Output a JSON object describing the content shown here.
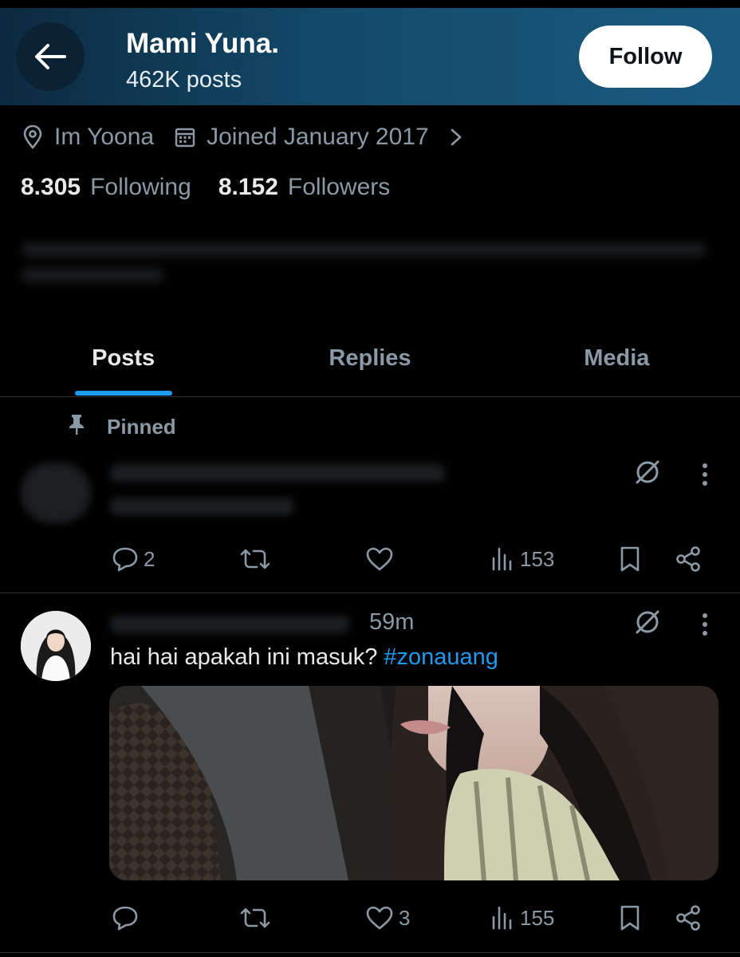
{
  "header": {
    "name": "Mami Yuna.",
    "posts_count": "462K posts",
    "follow_label": "Follow"
  },
  "profile": {
    "location": "Im Yoona",
    "joined": "Joined January 2017",
    "following_count": "8.305",
    "following_label": "Following",
    "followers_count": "8.152",
    "followers_label": "Followers"
  },
  "tabs": [
    {
      "label": "Posts",
      "active": true
    },
    {
      "label": "Replies",
      "active": false
    },
    {
      "label": "Media",
      "active": false
    }
  ],
  "pinned_post": {
    "pinned_label": "Pinned",
    "stats": {
      "replies": "2",
      "views": "153"
    }
  },
  "post": {
    "time": "59m",
    "text": "hai hai apakah ini masuk? ",
    "hashtag": "#zonauang",
    "stats": {
      "likes": "3",
      "views": "155"
    }
  },
  "colors": {
    "accent": "#1d9bf0",
    "muted": "#8b98a5",
    "text": "#e7e9ea",
    "background": "#000000"
  },
  "icons": [
    "back-arrow-icon",
    "location-icon",
    "calendar-icon",
    "chevron-right-icon",
    "pin-icon",
    "grok-icon",
    "more-icon",
    "reply-icon",
    "retweet-icon",
    "like-icon",
    "views-icon",
    "bookmark-icon",
    "share-icon"
  ]
}
